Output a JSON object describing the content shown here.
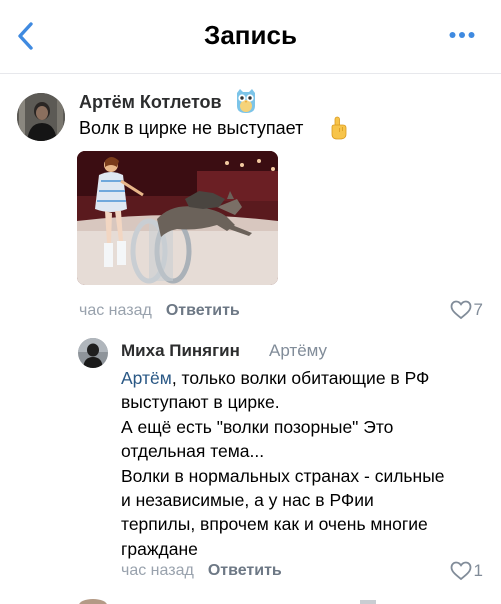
{
  "header": {
    "title": "Запись",
    "back_icon": "chevron-left-icon",
    "more_icon": "more-horizontal-icon",
    "accent": "#3f8ae0"
  },
  "comment": {
    "author": "Артём Котлетов",
    "badge_icon": "owl-icon",
    "text": "Волк в цирке не выступает",
    "emoji_icon": "pointing-up-hand-icon",
    "time": "час назад",
    "reply_label": "Ответить",
    "likes": "7"
  },
  "reply": {
    "author": "Миха Пинягин",
    "reply_to": "Артёму",
    "mention": "Артём",
    "lines": [
      ", только волки обитающие в РФ",
      "выступают в цирке.",
      "А ещё есть \"волки позорные\" Это",
      "отдельная тема...",
      "Волки в нормальных странах - сильные",
      "и независимые, а у нас в РФии",
      "терпилы, впрочем как и очень многие",
      "граждане"
    ],
    "time": "час назад",
    "reply_label": "Ответить",
    "likes": "1"
  },
  "colors": {
    "link": "#2a5885",
    "secondary_text": "#99a2ad",
    "separator": "#e7e8ec"
  }
}
